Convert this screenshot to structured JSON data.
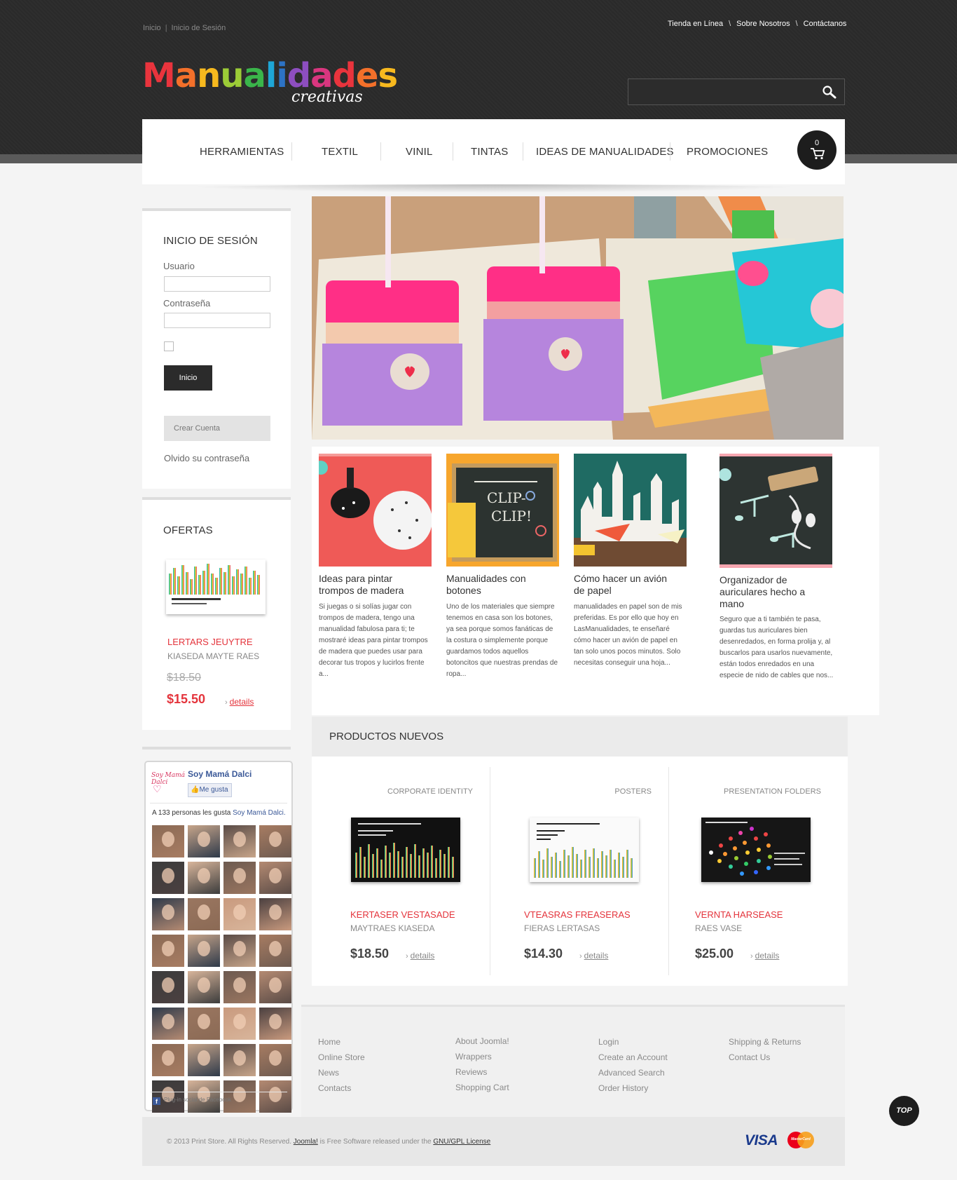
{
  "header": {
    "breadcrumb": [
      "Inicio",
      "Inicio de Sesión"
    ],
    "top_links": [
      "Tienda en Línea",
      "Sobre Nosotros",
      "Contáctanos"
    ],
    "logo_word": [
      "M",
      "a",
      "n",
      "u",
      "a",
      "l",
      "i",
      "d",
      "a",
      "d",
      "e",
      "s"
    ],
    "logo_sub": "creativas",
    "search_placeholder": ""
  },
  "nav": {
    "items": [
      "HERRAMIENTAS",
      "TEXTIL",
      "VINIL",
      "TINTAS",
      "IDEAS DE MANUALIDADES",
      "PROMOCIONES"
    ],
    "cart_count": "0"
  },
  "login": {
    "title": "INICIO DE SESIÓN",
    "user_label": "Usuario",
    "pass_label": "Contraseña",
    "submit": "Inicio",
    "create": "Crear Cuenta",
    "forgot": "Olvido su contraseña"
  },
  "offers": {
    "title": "OFERTAS",
    "name": "LERTARS JEUYTRE",
    "sub": "KIASEDA MAYTE RAES",
    "old_price": "$18.50",
    "price": "$15.50",
    "details": "details"
  },
  "articles": [
    {
      "title": "Ideas para pintar trompos de madera",
      "text": "Si juegas o si solías jugar con trompos de madera, tengo una manualidad fabulosa para ti; te mostraré ideas para pintar trompos de madera que puedes usar para decorar tus tropos y lucirlos frente a..."
    },
    {
      "title": "Manualidades con botones",
      "text": "Uno de los materiales que siempre tenemos en casa son los botones, ya sea porque somos fanáticas de la costura o simplemente porque guardamos todos aquellos botoncitos que nuestras prendas de ropa..."
    },
    {
      "title": "Cómo hacer un avión de papel",
      "text": "manualidades en papel son de mis preferidas. Es por ello que hoy en LasManualidades, te enseñaré cómo hacer un avión de papel en tan solo unos pocos minutos. Solo necesitas conseguir una hoja..."
    },
    {
      "title": "Organizador de auriculares hecho a mano",
      "text": "Seguro que a ti también te pasa, guardas tus auriculares bien desenredados, en forma prolija y, al buscarlos para usarlos nuevamente, están todos enredados en una especie de nido de cables que nos..."
    }
  ],
  "products": {
    "title": "PRODUCTOS NUEVOS",
    "items": [
      {
        "category": "CORPORATE IDENTITY",
        "name": "KERTASER VESTASADE",
        "sub": "MAYTRAES KIASEDA",
        "price": "$18.50",
        "details": "details"
      },
      {
        "category": "POSTERS",
        "name": "VTEASRAS FREASERAS",
        "sub": "FIERAS LERTASAS",
        "price": "$14.30",
        "details": "details"
      },
      {
        "category": "PRESENTATION FOLDERS",
        "name": "VERNTA HARSEASE",
        "sub": "RAES VASE",
        "price": "$25.00",
        "details": "details"
      }
    ]
  },
  "facebook": {
    "page_name": "Soy Mamá Dalci",
    "logo_text": "Soy Mamá Dalci",
    "like_button": "Me gusta",
    "count_prefix": "A 133 personas les gusta",
    "count_link": "Soy Mamá Dalci.",
    "plugin_text": "Plug-in social de Facebook"
  },
  "footer": {
    "col1": [
      "Home",
      "Online Store",
      "News",
      "Contacts"
    ],
    "col2": [
      "About Joomla!",
      "Wrappers",
      "Reviews",
      "Shopping Cart"
    ],
    "col3": [
      "Login",
      "Create an Account",
      "Advanced Search",
      "Order History"
    ],
    "col4": [
      "Shipping & Returns",
      "Contact Us"
    ],
    "copyright_prefix": "© 2013 Print Store. All Rights Reserved.",
    "joomla": "Joomla!",
    "middle": "is Free Software released under the",
    "license": "GNU/GPL License",
    "visa": "VISA",
    "mastercard": "MasterCard",
    "top": "TOP"
  },
  "colors": {
    "accent_red": "#e4343c",
    "header_bg": "#2a2a2a",
    "logo_letters": [
      "#e9343d",
      "#f3702a",
      "#f7b91e",
      "#9ccc37",
      "#3ab54a",
      "#1ea6d6",
      "#2d73c5",
      "#8d4ec0",
      "#d9367f",
      "#e9343d",
      "#f3702a",
      "#f7b91e"
    ]
  }
}
